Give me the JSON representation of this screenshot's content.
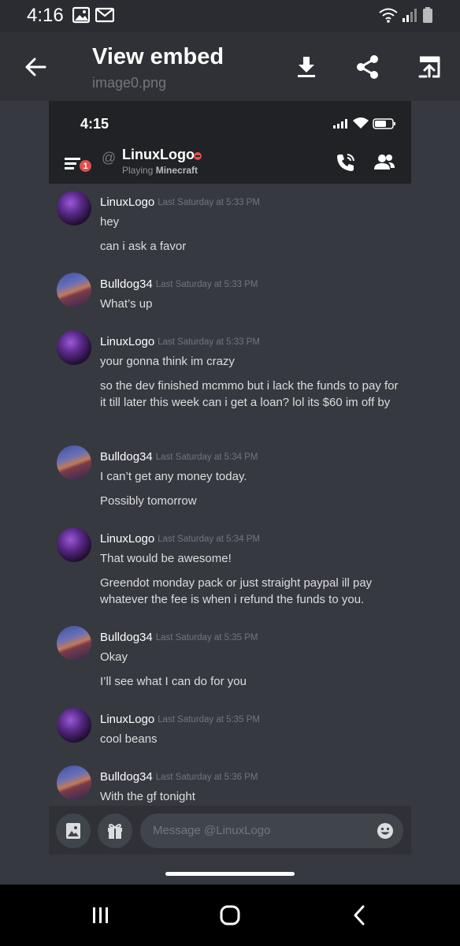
{
  "status_bar": {
    "time": "4:16",
    "icons": [
      "image-icon",
      "gmail-icon",
      "wifi-icon",
      "signal-icon",
      "battery-icon"
    ]
  },
  "header": {
    "title": "View embed",
    "subtitle": "image0.png",
    "icons": [
      "back-arrow-icon",
      "download-icon",
      "share-icon",
      "open-external-icon"
    ]
  },
  "embed": {
    "status_time": "4:15",
    "channel": {
      "at": "@",
      "username": "LinuxLogo",
      "activity_prefix": "Playing",
      "activity_game": "Minecraft",
      "badge_count": "1"
    },
    "messages": [
      {
        "author": "LinuxLogo",
        "timestamp": "Last Saturday at 5:33 PM",
        "lines": [
          "hey",
          "can i ask a favor"
        ]
      },
      {
        "author": "Bulldog34",
        "timestamp": "Last Saturday at 5:33 PM",
        "lines": [
          "What’s up"
        ]
      },
      {
        "author": "LinuxLogo",
        "timestamp": "Last Saturday at 5:33 PM",
        "lines": [
          "your gonna think im crazy",
          "so the dev finished mcmmo but i lack the funds to pay for it till later this week can i get a loan? lol its $60 im off by"
        ]
      },
      {
        "author": "Bulldog34",
        "timestamp": "Last Saturday at 5:34 PM",
        "lines": [
          "I can’t get any money today.",
          "Possibly tomorrow"
        ]
      },
      {
        "author": "LinuxLogo",
        "timestamp": "Last Saturday at 5:34 PM",
        "lines": [
          "That would be awesome!",
          "Greendot monday pack or just straight paypal ill pay whatever the fee is when i refund the funds to you."
        ]
      },
      {
        "author": "Bulldog34",
        "timestamp": "Last Saturday at 5:35 PM",
        "lines": [
          "Okay",
          "I’ll see what I can do for you"
        ]
      },
      {
        "author": "LinuxLogo",
        "timestamp": "Last Saturday at 5:35 PM",
        "lines": [
          "cool beans"
        ]
      },
      {
        "author": "Bulldog34",
        "timestamp": "Last Saturday at 5:36 PM",
        "lines": [
          "With the gf tonight"
        ]
      }
    ],
    "input": {
      "placeholder": "Message @LinuxLogo"
    }
  },
  "colors": {
    "accent_red": "#e24e4b",
    "background": "#36393f",
    "header_bg": "#2f3136",
    "timestamp": "#72767d"
  }
}
